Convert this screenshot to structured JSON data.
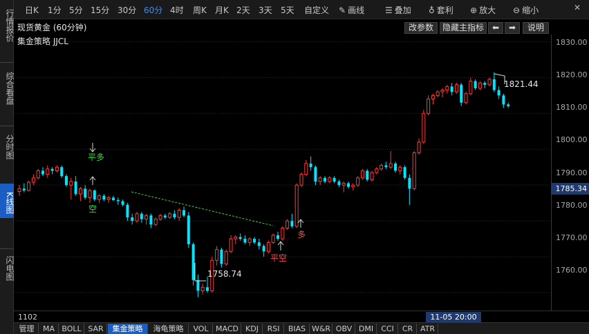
{
  "sidebar": {
    "items": [
      {
        "label": "行情报价",
        "active": false
      },
      {
        "label": "综合看盘",
        "active": false
      },
      {
        "label": "分时图",
        "active": false
      },
      {
        "label": "K线图",
        "active": true
      },
      {
        "label": "闪电图",
        "active": false
      }
    ]
  },
  "toolbar": {
    "periods": [
      "日K",
      "1分",
      "5分",
      "15分",
      "30分",
      "60分",
      "4时",
      "周K",
      "月K",
      "2天",
      "3天",
      "5天",
      "自定义"
    ],
    "active_period": "60分",
    "tools": [
      {
        "label": "画线",
        "icon": "pencil-icon"
      },
      {
        "label": "叠加",
        "icon": "database-stack-icon"
      },
      {
        "label": "套利",
        "icon": "money-bag-icon"
      },
      {
        "label": "放大",
        "icon": "zoom-in-icon"
      },
      {
        "label": "缩小",
        "icon": "zoom-out-icon"
      }
    ]
  },
  "header": {
    "title": "现货黄金 (60分钟)",
    "indicator": "集金策略 JJCL",
    "buttons": {
      "params": "改参数",
      "hide_main": "隐藏主指标",
      "prev": "⬅",
      "next": "➡",
      "help": "说明"
    }
  },
  "price_axis": {
    "labels": [
      "1830.00",
      "1820.00",
      "1810.00",
      "1800.00",
      "1790.00",
      "1780.00",
      "1770.00",
      "1760.00"
    ],
    "current": "1785.34"
  },
  "footer": {
    "bar_count": "1102",
    "cursor_time": "11-05 20:00"
  },
  "tabs": [
    "管理",
    "MA",
    "BOLL",
    "SAR",
    "集金策略",
    "海龟策略",
    "VOL",
    "MACD",
    "KDJ",
    "RSI",
    "BIAS",
    "W&R",
    "OBV",
    "DMI",
    "CCI",
    "CR",
    "ATR"
  ],
  "active_tab": "集金策略",
  "colors": {
    "up": "#ff3b3b",
    "down": "#00e5ff",
    "accent": "#1a5ec4",
    "signal_green": "#33dd33",
    "signal_red": "#ff4a4a"
  },
  "chart_data": {
    "type": "candlestick",
    "title": "现货黄金 (60分钟)",
    "ylim": [
      1755,
      1832
    ],
    "annotations": [
      {
        "text": "平多",
        "color": "green"
      },
      {
        "text": "空",
        "color": "green"
      },
      {
        "text": "多",
        "color": "red"
      },
      {
        "text": "平空",
        "color": "red"
      },
      {
        "text": "1758.74",
        "color": "white"
      },
      {
        "text": "1821.44",
        "color": "white"
      }
    ],
    "candles": [
      {
        "o": 1788.2,
        "h": 1790.0,
        "l": 1787.0,
        "c": 1789.0
      },
      {
        "o": 1789.0,
        "h": 1790.5,
        "l": 1788.0,
        "c": 1788.5
      },
      {
        "o": 1788.5,
        "h": 1791.2,
        "l": 1788.2,
        "c": 1790.8
      },
      {
        "o": 1790.8,
        "h": 1793.0,
        "l": 1790.0,
        "c": 1792.0
      },
      {
        "o": 1792.0,
        "h": 1794.5,
        "l": 1791.5,
        "c": 1794.0
      },
      {
        "o": 1794.0,
        "h": 1795.0,
        "l": 1792.5,
        "c": 1793.0
      },
      {
        "o": 1793.0,
        "h": 1795.5,
        "l": 1792.0,
        "c": 1794.5
      },
      {
        "o": 1794.5,
        "h": 1795.0,
        "l": 1793.0,
        "c": 1794.0
      },
      {
        "o": 1794.0,
        "h": 1795.5,
        "l": 1793.5,
        "c": 1795.0
      },
      {
        "o": 1795.0,
        "h": 1795.5,
        "l": 1792.0,
        "c": 1792.5
      },
      {
        "o": 1792.5,
        "h": 1793.0,
        "l": 1789.5,
        "c": 1790.0
      },
      {
        "o": 1790.0,
        "h": 1792.0,
        "l": 1786.0,
        "c": 1791.0
      },
      {
        "o": 1791.0,
        "h": 1792.5,
        "l": 1787.0,
        "c": 1787.5
      },
      {
        "o": 1787.5,
        "h": 1789.5,
        "l": 1785.5,
        "c": 1789.0
      },
      {
        "o": 1789.0,
        "h": 1790.0,
        "l": 1786.0,
        "c": 1786.5
      },
      {
        "o": 1786.5,
        "h": 1789.0,
        "l": 1785.0,
        "c": 1788.5
      },
      {
        "o": 1788.5,
        "h": 1788.8,
        "l": 1785.5,
        "c": 1786.0
      },
      {
        "o": 1786.0,
        "h": 1787.5,
        "l": 1785.0,
        "c": 1787.0
      },
      {
        "o": 1787.0,
        "h": 1787.5,
        "l": 1785.5,
        "c": 1786.0
      },
      {
        "o": 1786.0,
        "h": 1787.0,
        "l": 1785.0,
        "c": 1786.5
      },
      {
        "o": 1786.5,
        "h": 1787.0,
        "l": 1785.5,
        "c": 1785.8
      },
      {
        "o": 1785.8,
        "h": 1786.5,
        "l": 1784.5,
        "c": 1785.5
      },
      {
        "o": 1785.5,
        "h": 1786.0,
        "l": 1784.0,
        "c": 1784.5
      },
      {
        "o": 1784.5,
        "h": 1785.0,
        "l": 1780.0,
        "c": 1781.0
      },
      {
        "o": 1781.0,
        "h": 1782.0,
        "l": 1779.0,
        "c": 1780.0
      },
      {
        "o": 1780.0,
        "h": 1782.5,
        "l": 1779.5,
        "c": 1782.0
      },
      {
        "o": 1782.0,
        "h": 1782.5,
        "l": 1779.5,
        "c": 1780.5
      },
      {
        "o": 1780.5,
        "h": 1782.0,
        "l": 1779.0,
        "c": 1781.5
      },
      {
        "o": 1781.5,
        "h": 1782.0,
        "l": 1778.0,
        "c": 1779.0
      },
      {
        "o": 1779.0,
        "h": 1781.0,
        "l": 1778.5,
        "c": 1780.5
      },
      {
        "o": 1780.5,
        "h": 1782.0,
        "l": 1780.0,
        "c": 1781.5
      },
      {
        "o": 1781.5,
        "h": 1782.0,
        "l": 1780.5,
        "c": 1781.0
      },
      {
        "o": 1781.0,
        "h": 1782.5,
        "l": 1780.5,
        "c": 1782.0
      },
      {
        "o": 1782.0,
        "h": 1783.0,
        "l": 1780.5,
        "c": 1781.0
      },
      {
        "o": 1781.0,
        "h": 1783.5,
        "l": 1780.0,
        "c": 1783.0
      },
      {
        "o": 1783.0,
        "h": 1784.0,
        "l": 1781.0,
        "c": 1781.5
      },
      {
        "o": 1781.5,
        "h": 1782.5,
        "l": 1772.5,
        "c": 1773.5
      },
      {
        "o": 1773.5,
        "h": 1774.0,
        "l": 1762.0,
        "c": 1763.5
      },
      {
        "o": 1763.5,
        "h": 1765.0,
        "l": 1758.74,
        "c": 1760.5
      },
      {
        "o": 1760.5,
        "h": 1762.5,
        "l": 1759.5,
        "c": 1761.5
      },
      {
        "o": 1761.5,
        "h": 1764.5,
        "l": 1760.0,
        "c": 1760.5
      },
      {
        "o": 1760.5,
        "h": 1770.0,
        "l": 1760.0,
        "c": 1769.0
      },
      {
        "o": 1769.0,
        "h": 1773.0,
        "l": 1767.5,
        "c": 1772.0
      },
      {
        "o": 1772.0,
        "h": 1772.5,
        "l": 1767.0,
        "c": 1768.0
      },
      {
        "o": 1768.0,
        "h": 1772.0,
        "l": 1767.5,
        "c": 1771.5
      },
      {
        "o": 1771.5,
        "h": 1776.0,
        "l": 1771.0,
        "c": 1775.0
      },
      {
        "o": 1775.0,
        "h": 1776.0,
        "l": 1773.5,
        "c": 1775.5
      },
      {
        "o": 1775.5,
        "h": 1776.5,
        "l": 1774.5,
        "c": 1775.0
      },
      {
        "o": 1775.0,
        "h": 1776.0,
        "l": 1773.5,
        "c": 1774.0
      },
      {
        "o": 1774.0,
        "h": 1775.5,
        "l": 1773.0,
        "c": 1775.0
      },
      {
        "o": 1775.0,
        "h": 1775.5,
        "l": 1773.5,
        "c": 1774.0
      },
      {
        "o": 1774.0,
        "h": 1775.0,
        "l": 1772.0,
        "c": 1773.0
      },
      {
        "o": 1773.0,
        "h": 1773.5,
        "l": 1770.0,
        "c": 1771.5
      },
      {
        "o": 1771.5,
        "h": 1774.5,
        "l": 1771.0,
        "c": 1774.0
      },
      {
        "o": 1774.0,
        "h": 1776.5,
        "l": 1773.5,
        "c": 1776.0
      },
      {
        "o": 1776.0,
        "h": 1777.0,
        "l": 1774.5,
        "c": 1775.0
      },
      {
        "o": 1775.0,
        "h": 1778.5,
        "l": 1774.5,
        "c": 1778.0
      },
      {
        "o": 1778.0,
        "h": 1780.5,
        "l": 1777.5,
        "c": 1780.0
      },
      {
        "o": 1780.0,
        "h": 1782.0,
        "l": 1778.0,
        "c": 1778.5
      },
      {
        "o": 1778.5,
        "h": 1790.5,
        "l": 1778.0,
        "c": 1790.0
      },
      {
        "o": 1790.0,
        "h": 1793.5,
        "l": 1789.5,
        "c": 1793.0
      },
      {
        "o": 1793.0,
        "h": 1797.0,
        "l": 1792.5,
        "c": 1796.0
      },
      {
        "o": 1796.0,
        "h": 1798.0,
        "l": 1794.0,
        "c": 1795.0
      },
      {
        "o": 1795.0,
        "h": 1795.5,
        "l": 1790.0,
        "c": 1791.0
      },
      {
        "o": 1791.0,
        "h": 1792.5,
        "l": 1790.0,
        "c": 1792.0
      },
      {
        "o": 1792.0,
        "h": 1792.5,
        "l": 1790.5,
        "c": 1791.0
      },
      {
        "o": 1791.0,
        "h": 1792.5,
        "l": 1790.5,
        "c": 1792.0
      },
      {
        "o": 1792.0,
        "h": 1792.5,
        "l": 1790.5,
        "c": 1791.0
      },
      {
        "o": 1791.0,
        "h": 1791.5,
        "l": 1789.5,
        "c": 1790.0
      },
      {
        "o": 1790.0,
        "h": 1791.0,
        "l": 1788.0,
        "c": 1790.5
      },
      {
        "o": 1790.5,
        "h": 1791.0,
        "l": 1789.0,
        "c": 1789.5
      },
      {
        "o": 1789.5,
        "h": 1790.5,
        "l": 1788.5,
        "c": 1790.0
      },
      {
        "o": 1790.0,
        "h": 1792.5,
        "l": 1789.5,
        "c": 1792.0
      },
      {
        "o": 1792.0,
        "h": 1794.5,
        "l": 1791.5,
        "c": 1794.0
      },
      {
        "o": 1794.0,
        "h": 1794.5,
        "l": 1791.0,
        "c": 1791.5
      },
      {
        "o": 1791.5,
        "h": 1794.0,
        "l": 1791.0,
        "c": 1793.5
      },
      {
        "o": 1793.5,
        "h": 1795.0,
        "l": 1793.0,
        "c": 1794.5
      },
      {
        "o": 1794.5,
        "h": 1796.0,
        "l": 1794.0,
        "c": 1795.5
      },
      {
        "o": 1795.5,
        "h": 1796.5,
        "l": 1794.5,
        "c": 1795.0
      },
      {
        "o": 1795.0,
        "h": 1799.5,
        "l": 1794.5,
        "c": 1796.0
      },
      {
        "o": 1796.0,
        "h": 1796.5,
        "l": 1793.5,
        "c": 1794.0
      },
      {
        "o": 1794.0,
        "h": 1795.5,
        "l": 1793.0,
        "c": 1795.0
      },
      {
        "o": 1795.0,
        "h": 1795.5,
        "l": 1791.5,
        "c": 1792.0
      },
      {
        "o": 1792.0,
        "h": 1793.0,
        "l": 1784.5,
        "c": 1789.0
      },
      {
        "o": 1789.0,
        "h": 1799.5,
        "l": 1788.5,
        "c": 1799.0
      },
      {
        "o": 1799.0,
        "h": 1803.0,
        "l": 1798.5,
        "c": 1802.0
      },
      {
        "o": 1802.0,
        "h": 1811.0,
        "l": 1801.5,
        "c": 1810.0
      },
      {
        "o": 1810.0,
        "h": 1815.0,
        "l": 1809.5,
        "c": 1814.0
      },
      {
        "o": 1814.0,
        "h": 1815.5,
        "l": 1812.5,
        "c": 1815.0
      },
      {
        "o": 1815.0,
        "h": 1816.5,
        "l": 1814.5,
        "c": 1816.0
      },
      {
        "o": 1816.0,
        "h": 1817.0,
        "l": 1814.5,
        "c": 1816.5
      },
      {
        "o": 1816.5,
        "h": 1818.0,
        "l": 1815.5,
        "c": 1817.5
      },
      {
        "o": 1817.5,
        "h": 1818.5,
        "l": 1815.0,
        "c": 1816.0
      },
      {
        "o": 1816.0,
        "h": 1818.5,
        "l": 1815.5,
        "c": 1818.0
      },
      {
        "o": 1818.0,
        "h": 1818.5,
        "l": 1812.0,
        "c": 1813.0
      },
      {
        "o": 1813.0,
        "h": 1816.0,
        "l": 1812.5,
        "c": 1815.5
      },
      {
        "o": 1815.5,
        "h": 1820.0,
        "l": 1815.0,
        "c": 1819.0
      },
      {
        "o": 1819.0,
        "h": 1819.5,
        "l": 1816.5,
        "c": 1817.0
      },
      {
        "o": 1817.0,
        "h": 1819.0,
        "l": 1816.5,
        "c": 1818.5
      },
      {
        "o": 1818.5,
        "h": 1819.0,
        "l": 1817.0,
        "c": 1818.0
      },
      {
        "o": 1818.0,
        "h": 1820.0,
        "l": 1817.5,
        "c": 1819.5
      },
      {
        "o": 1819.5,
        "h": 1821.44,
        "l": 1816.0,
        "c": 1816.5
      },
      {
        "o": 1816.5,
        "h": 1817.5,
        "l": 1814.0,
        "c": 1815.0
      },
      {
        "o": 1815.0,
        "h": 1815.5,
        "l": 1811.5,
        "c": 1812.5
      },
      {
        "o": 1812.5,
        "h": 1813.0,
        "l": 1811.5,
        "c": 1812.0
      }
    ]
  }
}
